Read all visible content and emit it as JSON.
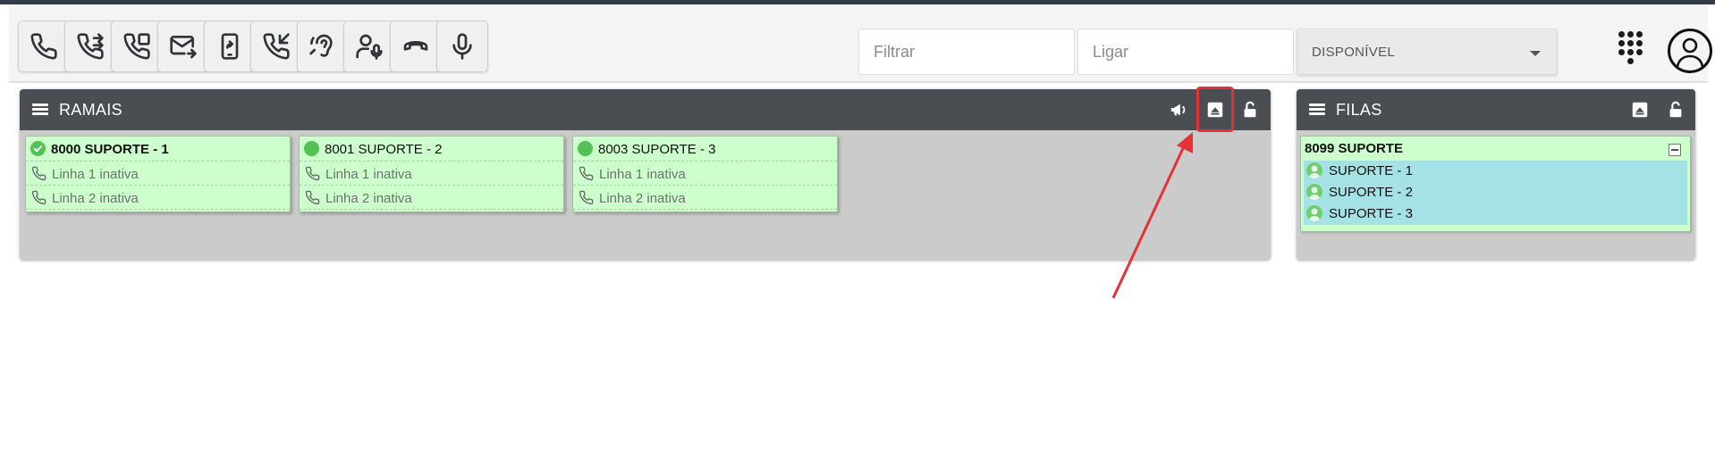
{
  "toolbar": {
    "buttons": [
      {
        "name": "phone-icon"
      },
      {
        "name": "transfer-call-icon"
      },
      {
        "name": "consult-transfer-icon"
      },
      {
        "name": "forward-mail-icon"
      },
      {
        "name": "mobile-forward-icon"
      },
      {
        "name": "pickup-call-icon"
      },
      {
        "name": "listen-ear-icon"
      },
      {
        "name": "user-voice-icon"
      },
      {
        "name": "hangup-icon"
      },
      {
        "name": "microphone-icon"
      }
    ],
    "filter_placeholder": "Filtrar",
    "dial_placeholder": "Ligar",
    "status_value": "DISPONÍVEL"
  },
  "ramais": {
    "title": "RAMAIS",
    "extensions": [
      {
        "label": "8000 SUPORTE - 1",
        "status": "check",
        "lines": [
          "Linha 1 inativa",
          "Linha 2 inativa"
        ]
      },
      {
        "label": "8001 SUPORTE - 2",
        "status": "available",
        "lines": [
          "Linha 1 inativa",
          "Linha 2 inativa"
        ]
      },
      {
        "label": "8003 SUPORTE - 3",
        "status": "available",
        "lines": [
          "Linha 1 inativa",
          "Linha 2 inativa"
        ]
      }
    ]
  },
  "filas": {
    "title": "FILAS",
    "queues": [
      {
        "label": "8099 SUPORTE",
        "members": [
          "SUPORTE - 1",
          "SUPORTE - 2",
          "SUPORTE - 3"
        ]
      }
    ]
  },
  "colors": {
    "panel_header": "#4a4d52",
    "card_green": "#ccffcc",
    "member_cyan": "#a5e2e6",
    "status_dot": "#52c254",
    "annotation_red": "#e53238"
  }
}
